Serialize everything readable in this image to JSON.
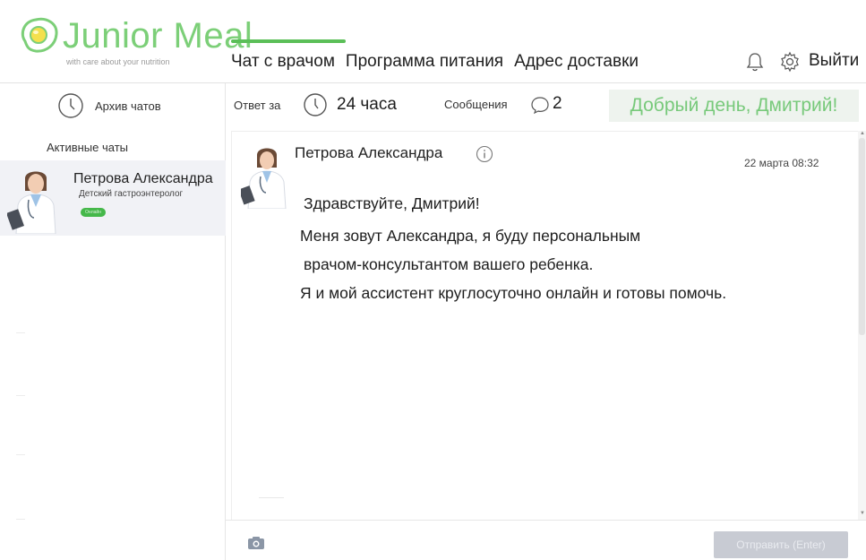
{
  "brand": {
    "name": "Junior Meal",
    "tagline": "with care about your nutrition",
    "accent_color": "#7ccf78"
  },
  "nav": {
    "items": [
      {
        "label": "Чат с врачом",
        "active": true
      },
      {
        "label": "Программа питания"
      },
      {
        "label": "Адрес доставки"
      }
    ],
    "notifications_icon": "bell-icon",
    "settings_icon": "gear-icon",
    "logout_label": "Выйти"
  },
  "sidebar": {
    "archive_label": "Архив чатов",
    "active_chats_title": "Активные чаты",
    "chats": [
      {
        "name": "Петрова Александра",
        "role": "Детский гастроэнтеролог",
        "status": "Онлайн",
        "status_color": "#45b84a"
      }
    ]
  },
  "infobar": {
    "response_label": "Ответ за",
    "response_value": "24 часа",
    "messages_label": "Сообщения",
    "messages_count": "2",
    "greeting": "Добрый день, Дмитрий!"
  },
  "conversation": {
    "messages": [
      {
        "author": "Петрова Александра",
        "time": "22 марта 08:32",
        "lines": [
          "Здравствуйте, Дмитрий!",
          "Меня зовут Александра, я буду персональным",
          "врачом-консультантом вашего ребенка.",
          "Я и мой ассистент круглосуточно онлайн и готовы помочь."
        ]
      }
    ]
  },
  "composer": {
    "attach_icon": "camera-icon",
    "send_label": "Отправить (Enter)"
  }
}
